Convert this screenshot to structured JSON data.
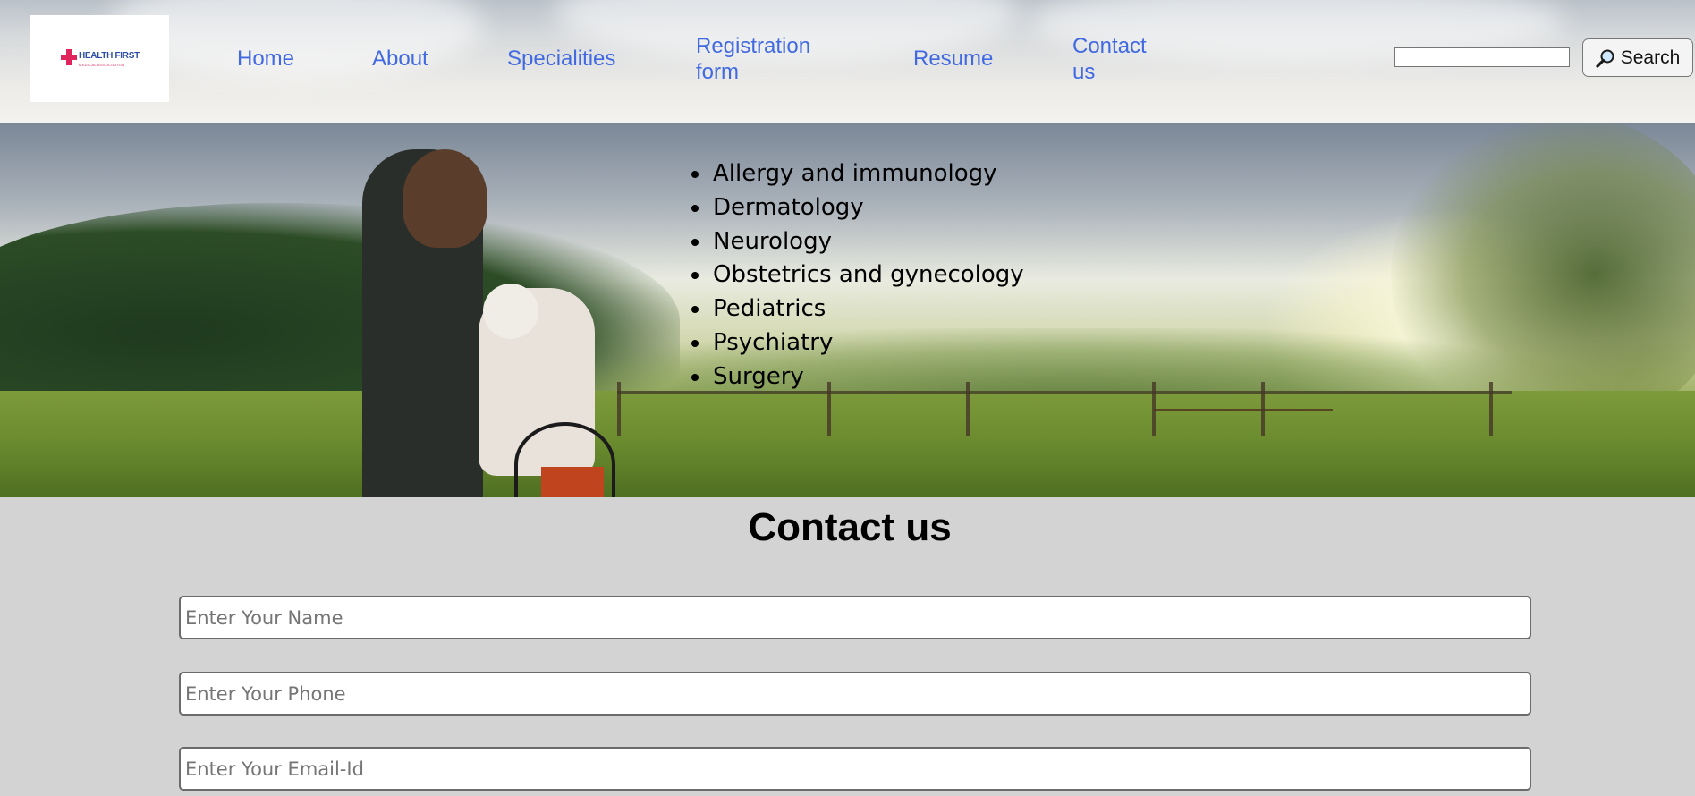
{
  "logo": {
    "name": "HEALTH FIRST",
    "tagline": "MEDICAL ASSOCIATION"
  },
  "nav": [
    {
      "label": "Home"
    },
    {
      "label": "About"
    },
    {
      "label": "Specialities"
    },
    {
      "label": "Registration form"
    },
    {
      "label": "Resume"
    },
    {
      "label": "Contact us"
    }
  ],
  "search": {
    "value": "",
    "button_label": "Search",
    "button_icon": "magnifier-icon"
  },
  "specialities": [
    "Allergy and immunology",
    "Dermatology",
    "Neurology",
    "Obstetrics and gynecology",
    "Pediatrics",
    "Psychiatry",
    "Surgery"
  ],
  "contact": {
    "title": "Contact us",
    "name_placeholder": "Enter Your Name",
    "phone_placeholder": "Enter Your Phone",
    "email_placeholder": "Enter Your Email-Id"
  },
  "colors": {
    "nav_link": "#4169e1",
    "page_bg": "#d3d3d3",
    "logo_accent": "#e0245e",
    "logo_text": "#2e4fa3"
  }
}
